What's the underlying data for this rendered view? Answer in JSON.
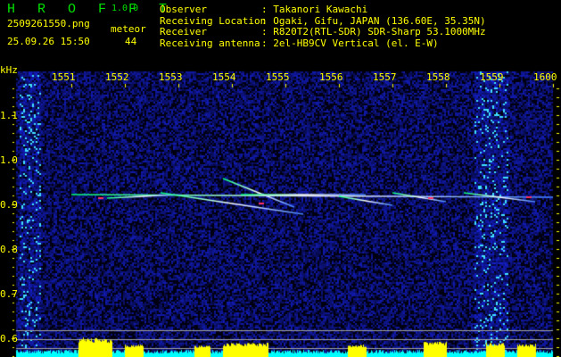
{
  "app": {
    "title": "H R O F F T",
    "version": "1.0.0",
    "filename": "2509261550.png",
    "datetime": "25.09.26 15:50",
    "meteor_label": "meteor",
    "meteor_count": "44"
  },
  "info": [
    {
      "label": "Observer",
      "value": ": Takanori Kawachi"
    },
    {
      "label": "Receiving Location",
      "value": ": Ogaki, Gifu, JAPAN (136.60E, 35.35N)"
    },
    {
      "label": "Receiver",
      "value": ": R820T2(RTL-SDR) SDR-Sharp 53.1000MHz"
    },
    {
      "label": "Receiving antenna",
      "value": ": 2el-HB9CV Vertical (el. E-W)"
    }
  ],
  "axis": {
    "unit": "kHz",
    "x_ticks": [
      "1551",
      "1552",
      "1553",
      "1554",
      "1555",
      "1556",
      "1557",
      "1558",
      "1559",
      "1600"
    ],
    "y_ticks": [
      "1.1",
      "1.0",
      "0.9",
      "0.8",
      "0.7",
      "0.6"
    ]
  },
  "colors": {
    "noise": "#1020c0",
    "trace": "#80ffff",
    "histogram_high": "#ffff00",
    "histogram_low": "#00ffff"
  }
}
